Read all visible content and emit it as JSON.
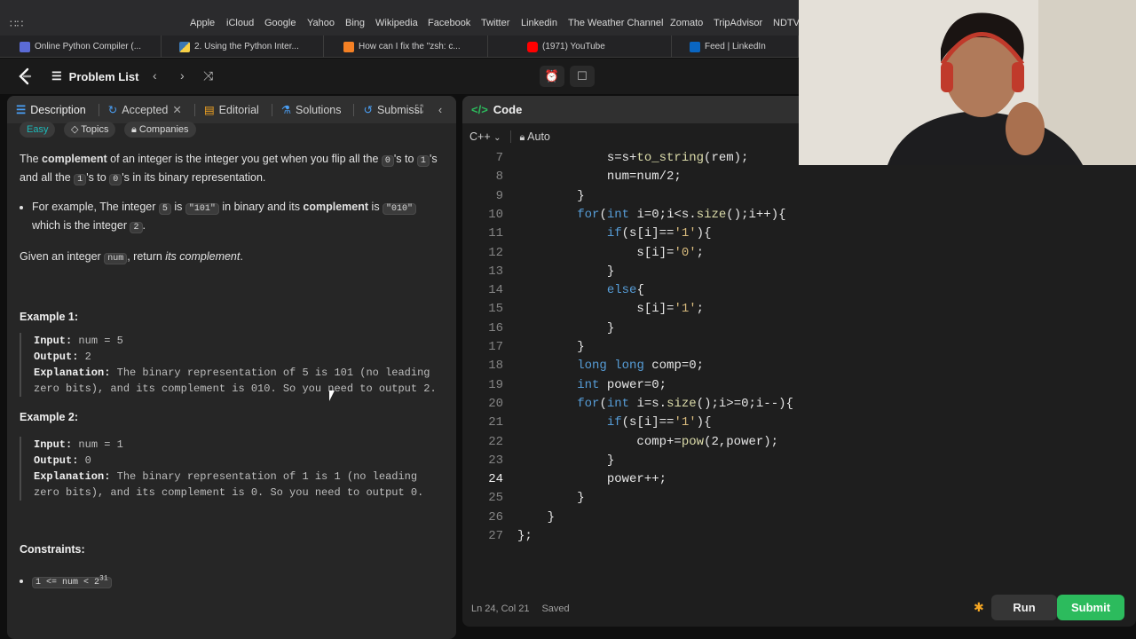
{
  "browser": {
    "bookmarks": [
      "Apple",
      "iCloud",
      "Google",
      "Yahoo",
      "Bing",
      "Wikipedia",
      "Facebook",
      "Twitter",
      "Linkedin",
      "The Weather Channel",
      "Zomato",
      "TripAdvisor",
      "NDTV"
    ],
    "tabs": [
      {
        "label": "Online Python Compiler (...",
        "icon": "python-icon"
      },
      {
        "label": "2. Using the Python Inter...",
        "icon": "python-icon"
      },
      {
        "label": "How can I fix the \"zsh: c...",
        "icon": "stackoverflow-icon"
      },
      {
        "label": "(1971) YouTube",
        "icon": "youtube-icon"
      },
      {
        "label": "Feed | LinkedIn",
        "icon": "linkedin-icon"
      }
    ]
  },
  "nav": {
    "problem_list": "Problem List"
  },
  "left_tabs": {
    "description": "Description",
    "accepted": "Accepted",
    "editorial": "Editorial",
    "solutions": "Solutions",
    "submissions": "Submissi"
  },
  "tags": {
    "difficulty": "Easy",
    "topics": "Topics",
    "companies": "Companies"
  },
  "problem": {
    "p1_a": "The ",
    "p1_b": "complement",
    "p1_c": " of an integer is the integer you get when you flip all the ",
    "p1_code1": "0",
    "p1_d": "'s to ",
    "p1_code2": "1",
    "p1_e": "'s and all the ",
    "p1_code3": "1",
    "p1_f": "'s to ",
    "p1_code4": "0",
    "p1_g": "'s in its binary representation.",
    "bullet_a": "For example, The integer ",
    "bullet_code1": "5",
    "bullet_b": " is ",
    "bullet_code2": "\"101\"",
    "bullet_c": " in binary and its ",
    "bullet_bold": "complement",
    "bullet_d": " is ",
    "bullet_code3": "\"010\"",
    "bullet_e": " which is the integer ",
    "bullet_code4": "2",
    "bullet_f": ".",
    "given_a": "Given an integer ",
    "given_code": "num",
    "given_b": ", return ",
    "given_em": "its complement",
    "given_c": "."
  },
  "examples": [
    {
      "title": "Example 1:",
      "input_label": "Input:",
      "input": " num = 5",
      "output_label": "Output:",
      "output": " 2",
      "expl_label": "Explanation:",
      "expl": " The binary representation of 5 is 101 (no leading zero bits), and its complement is 010. So you need to output 2."
    },
    {
      "title": "Example 2:",
      "input_label": "Input:",
      "input": " num = 1",
      "output_label": "Output:",
      "output": " 0",
      "expl_label": "Explanation:",
      "expl": " The binary representation of 1 is 1 (no leading zero bits), and its complement is 0. So you need to output 0."
    }
  ],
  "constraints": {
    "title": "Constraints:",
    "item": "1 <= num < 2",
    "sup": "31"
  },
  "editor": {
    "header": "Code",
    "language": "C++",
    "mode": "Auto",
    "status_pos": "Ln 24, Col 21",
    "status_saved": "Saved",
    "run": "Run",
    "submit": "Submit",
    "lines": [
      {
        "n": "7",
        "t": "            s=s+to_string(rem);"
      },
      {
        "n": "8",
        "t": "            num=num/2;"
      },
      {
        "n": "9",
        "t": "        }"
      },
      {
        "n": "10",
        "t": "        for(int i=0;i<s.size();i++){"
      },
      {
        "n": "11",
        "t": "            if(s[i]=='1'){"
      },
      {
        "n": "12",
        "t": "                s[i]='0';"
      },
      {
        "n": "13",
        "t": "            }"
      },
      {
        "n": "14",
        "t": "            else{"
      },
      {
        "n": "15",
        "t": "                s[i]='1';"
      },
      {
        "n": "16",
        "t": "            }"
      },
      {
        "n": "17",
        "t": "        }"
      },
      {
        "n": "18",
        "t": "        long long comp=0;"
      },
      {
        "n": "19",
        "t": "        int power=0;"
      },
      {
        "n": "20",
        "t": "        for(int i=s.size();i>=0;i--){"
      },
      {
        "n": "21",
        "t": "            if(s[i]=='1'){"
      },
      {
        "n": "22",
        "t": "                comp+=pow(2,power);"
      },
      {
        "n": "23",
        "t": "            }"
      },
      {
        "n": "24",
        "t": "            power++;"
      },
      {
        "n": "25",
        "t": "        }"
      },
      {
        "n": "26",
        "t": "    }"
      },
      {
        "n": "27",
        "t": "};"
      }
    ]
  },
  "colors": {
    "accent_green": "#2cbb5d",
    "easy_teal": "#1cbaba",
    "keyword_blue": "#569cd6"
  }
}
